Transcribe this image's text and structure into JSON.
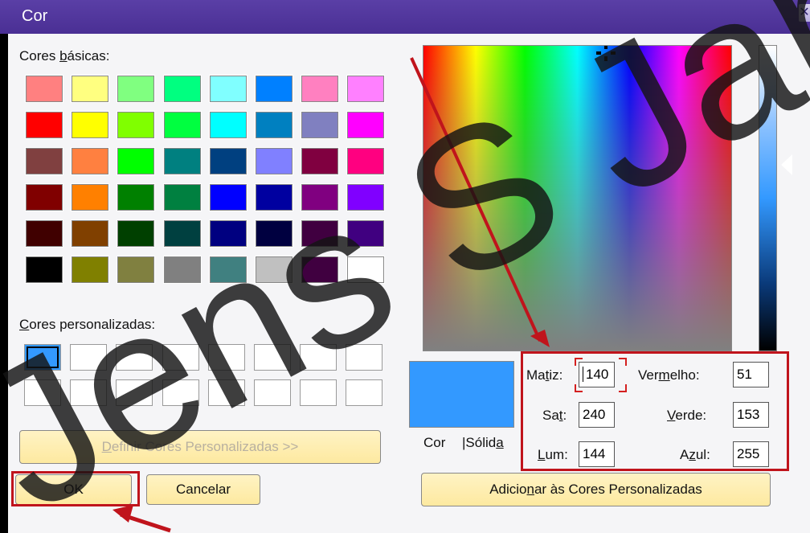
{
  "window": {
    "title": "Cor",
    "close_glyph": "✕"
  },
  "basic": {
    "label_pre": "Cores ",
    "label_u": "b",
    "label_post": "ásicas:",
    "colors": [
      "#ff8080",
      "#ffff80",
      "#80ff80",
      "#00ff80",
      "#80ffff",
      "#0080ff",
      "#ff80c0",
      "#ff80ff",
      "#ff0000",
      "#ffff00",
      "#80ff00",
      "#00ff40",
      "#00ffff",
      "#0080c0",
      "#8080c0",
      "#ff00ff",
      "#804040",
      "#ff8040",
      "#00ff00",
      "#008080",
      "#004080",
      "#8080ff",
      "#800040",
      "#ff0080",
      "#800000",
      "#ff8000",
      "#008000",
      "#008040",
      "#0000ff",
      "#0000a0",
      "#800080",
      "#8000ff",
      "#400000",
      "#804000",
      "#004000",
      "#004040",
      "#000080",
      "#000040",
      "#400040",
      "#400080",
      "#000000",
      "#808000",
      "#808040",
      "#808080",
      "#408080",
      "#c0c0c0",
      "#400040",
      "#ffffff"
    ]
  },
  "custom": {
    "label_u": "C",
    "label_post": "ores personalizadas:",
    "colors": [
      "#3399ff",
      "#ffffff",
      "#ffffff",
      "#ffffff",
      "#ffffff",
      "#ffffff",
      "#ffffff",
      "#ffffff",
      "#ffffff",
      "#ffffff",
      "#ffffff",
      "#ffffff",
      "#ffffff",
      "#ffffff",
      "#ffffff",
      "#ffffff"
    ]
  },
  "buttons": {
    "define_pre": "",
    "define_u": "D",
    "define_post": "efinir Cores Personalizadas >>",
    "ok": "OK",
    "cancel": "Cancelar",
    "add_pre": "Adicio",
    "add_u": "n",
    "add_post": "ar às Cores Personalizadas"
  },
  "preview": {
    "color": "#3399ff",
    "label_a": "Cor",
    "label_b_pre": "|Sólid",
    "label_b_u": "a"
  },
  "values": {
    "hue_pre": "Ma",
    "hue_u": "t",
    "hue_post": "iz:",
    "hue": "140",
    "sat_pre": "Sa",
    "sat_u": "t",
    "sat_post": ":",
    "sat": "240",
    "lum_pre": "",
    "lum_u": "L",
    "lum_post": "um:",
    "lum": "144",
    "red_pre": "Ver",
    "red_u": "m",
    "red_post": "elho:",
    "red": "51",
    "green_pre": "",
    "green_u": "V",
    "green_post": "erde:",
    "green": "153",
    "blue_pre": "A",
    "blue_u": "z",
    "blue_post": "ul:",
    "blue": "255"
  },
  "watermark": {
    "text": "Jens S Jan"
  },
  "annotations": {
    "color": "#c0141c"
  }
}
